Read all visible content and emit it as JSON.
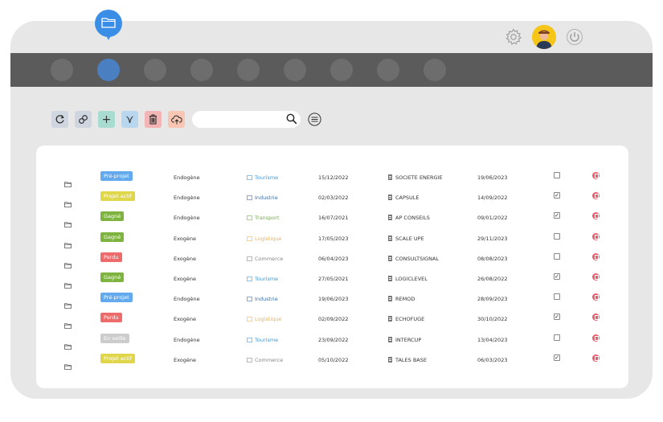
{
  "header": {
    "nav_item_count": 9,
    "active_nav_index": 1,
    "icons": [
      "folder-icon",
      "gear-icon",
      "user-avatar",
      "power-icon"
    ]
  },
  "toolbar": {
    "buttons": [
      {
        "name": "refresh-button",
        "icon": "refresh-icon",
        "color": "#cfd6df"
      },
      {
        "name": "link-button",
        "icon": "link-icon",
        "color": "#cfd6df"
      },
      {
        "name": "add-button",
        "icon": "plus-icon",
        "glyph": "+",
        "color": "#a8dcd1"
      },
      {
        "name": "filter-button",
        "icon": "filter-icon",
        "glyph": "⋎",
        "color": "#b9d6ef"
      },
      {
        "name": "delete-button",
        "icon": "trash-icon",
        "color": "#f2b4b4"
      },
      {
        "name": "upload-button",
        "icon": "cloud-upload-icon",
        "color": "#f9c6b4"
      }
    ],
    "search_value": "",
    "search_placeholder": ""
  },
  "status_colors": {
    "Pré-projet": "#63a9ee",
    "Projet actif": "#e0d64a",
    "Gagné": "#7db33e",
    "Perdu": "#ee6b6b",
    "En veille": "#cccccc"
  },
  "sector_colors": {
    "Tourisme": "#3a9ad9",
    "Industrie": "#3a6ea8",
    "Transport": "#6cb33f",
    "Logistique": "#f2b24a",
    "Commerce": "#888888"
  },
  "rows": [
    {
      "status": "Pré-projet",
      "type": "Endogène",
      "sector": "Tourisme",
      "date1": "15/12/2022",
      "company": "SOCIETE ENERGIE",
      "date2": "19/06/2023",
      "checked": false
    },
    {
      "status": "Projet actif",
      "type": "Endogène",
      "sector": "Industrie",
      "date1": "02/03/2022",
      "company": "CAPSULE",
      "date2": "14/09/2022",
      "checked": true
    },
    {
      "status": "Gagné",
      "type": "Endogène",
      "sector": "Transport",
      "date1": "16/07/2021",
      "company": "AP CONSEILS",
      "date2": "09/01/2022",
      "checked": true
    },
    {
      "status": "Gagné",
      "type": "Exogène",
      "sector": "Logistique",
      "date1": "17/05/2023",
      "company": "SCALE UPE",
      "date2": "29/11/2023",
      "checked": false
    },
    {
      "status": "Perdu",
      "type": "Exogène",
      "sector": "Commerce",
      "date1": "06/04/2023",
      "company": "CONSULTSIGNAL",
      "date2": "08/08/2023",
      "checked": false
    },
    {
      "status": "Gagné",
      "type": "Exogène",
      "sector": "Tourisme",
      "date1": "27/05/2021",
      "company": "LOGICLEVEL",
      "date2": "26/08/2022",
      "checked": true
    },
    {
      "status": "Pré-projet",
      "type": "Endogène",
      "sector": "Industrie",
      "date1": "19/06/2023",
      "company": "REMOD",
      "date2": "28/09/2023",
      "checked": false
    },
    {
      "status": "Perdu",
      "type": "Exogène",
      "sector": "Logistique",
      "date1": "02/09/2022",
      "company": "ECHOFUGE",
      "date2": "30/10/2022",
      "checked": true
    },
    {
      "status": "En veille",
      "type": "Endogène",
      "sector": "Tourisme",
      "date1": "23/09/2022",
      "company": "INTERCUP",
      "date2": "13/04/2023",
      "checked": false
    },
    {
      "status": "Projet actif",
      "type": "Exogène",
      "sector": "Commerce",
      "date1": "05/10/2022",
      "company": "TALES BASE",
      "date2": "06/03/2023",
      "checked": true
    }
  ]
}
